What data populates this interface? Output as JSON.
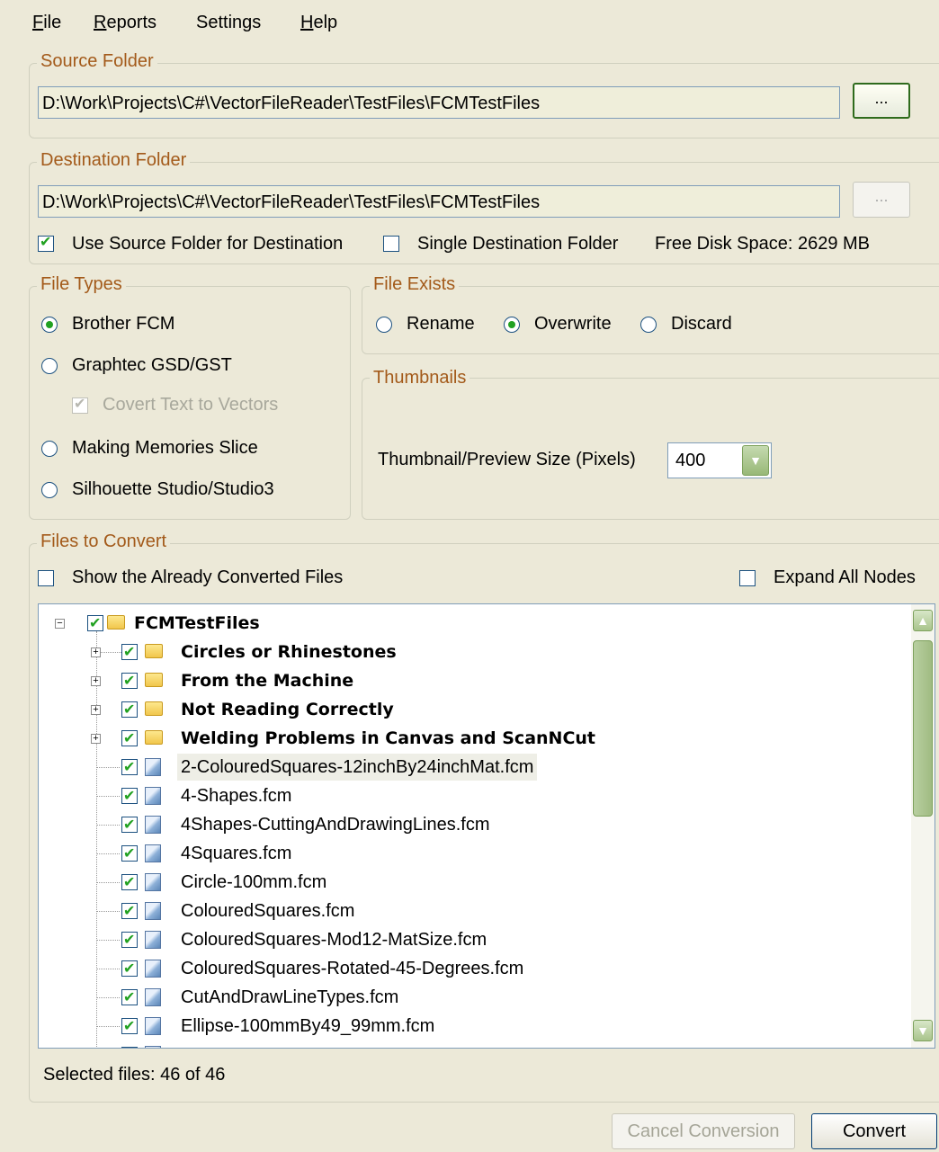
{
  "menu": {
    "file": {
      "ul": "F",
      "rest": "ile"
    },
    "reports": {
      "ul": "R",
      "rest": "eports"
    },
    "settings": "Settings",
    "help": {
      "ul": "H",
      "rest": "elp"
    }
  },
  "source_folder": {
    "title": "Source Folder",
    "path": "D:\\Work\\Projects\\C#\\VectorFileReader\\TestFiles\\FCMTestFiles",
    "browse_label": "..."
  },
  "destination_folder": {
    "title": "Destination Folder",
    "path": "D:\\Work\\Projects\\C#\\VectorFileReader\\TestFiles\\FCMTestFiles",
    "browse_label": "...",
    "use_source_label": "Use Source Folder for Destination",
    "use_source_checked": true,
    "single_dest_label": "Single Destination Folder",
    "single_dest_checked": false,
    "free_disk_space": "Free Disk Space: 2629 MB"
  },
  "file_types": {
    "title": "File Types",
    "options": [
      "Brother FCM",
      "Graphtec GSD/GST",
      "Making Memories Slice",
      "Silhouette Studio/Studio3"
    ],
    "selected": "Brother FCM",
    "convert_text_label": "Covert Text to Vectors"
  },
  "file_exists": {
    "title": "File Exists",
    "options": [
      "Rename",
      "Overwrite",
      "Discard"
    ],
    "selected": "Overwrite"
  },
  "thumbnails": {
    "title": "Thumbnails",
    "size_label": "Thumbnail/Preview Size (Pixels)",
    "size_value": "400"
  },
  "files_to_convert": {
    "title": "Files to Convert",
    "show_converted_label": "Show the Already Converted Files",
    "expand_all_label": "Expand All Nodes",
    "root": "FCMTestFiles",
    "folders": [
      "Circles or Rhinestones",
      "From the Machine",
      "Not Reading Correctly",
      "Welding Problems in Canvas and ScanNCut"
    ],
    "files": [
      "2-ColouredSquares-12inchBy24inchMat.fcm",
      "4-Shapes.fcm",
      "4Shapes-CuttingAndDrawingLines.fcm",
      "4Squares.fcm",
      "Circle-100mm.fcm",
      "ColouredSquares.fcm",
      "ColouredSquares-Mod12-MatSize.fcm",
      "ColouredSquares-Rotated-45-Degrees.fcm",
      "CutAndDrawLineTypes.fcm",
      "Ellipse-100mmBy49_99mm.fcm"
    ],
    "selected_count": "Selected files: 46 of 46"
  },
  "buttons": {
    "cancel": "Cancel Conversion",
    "convert": "Convert"
  }
}
